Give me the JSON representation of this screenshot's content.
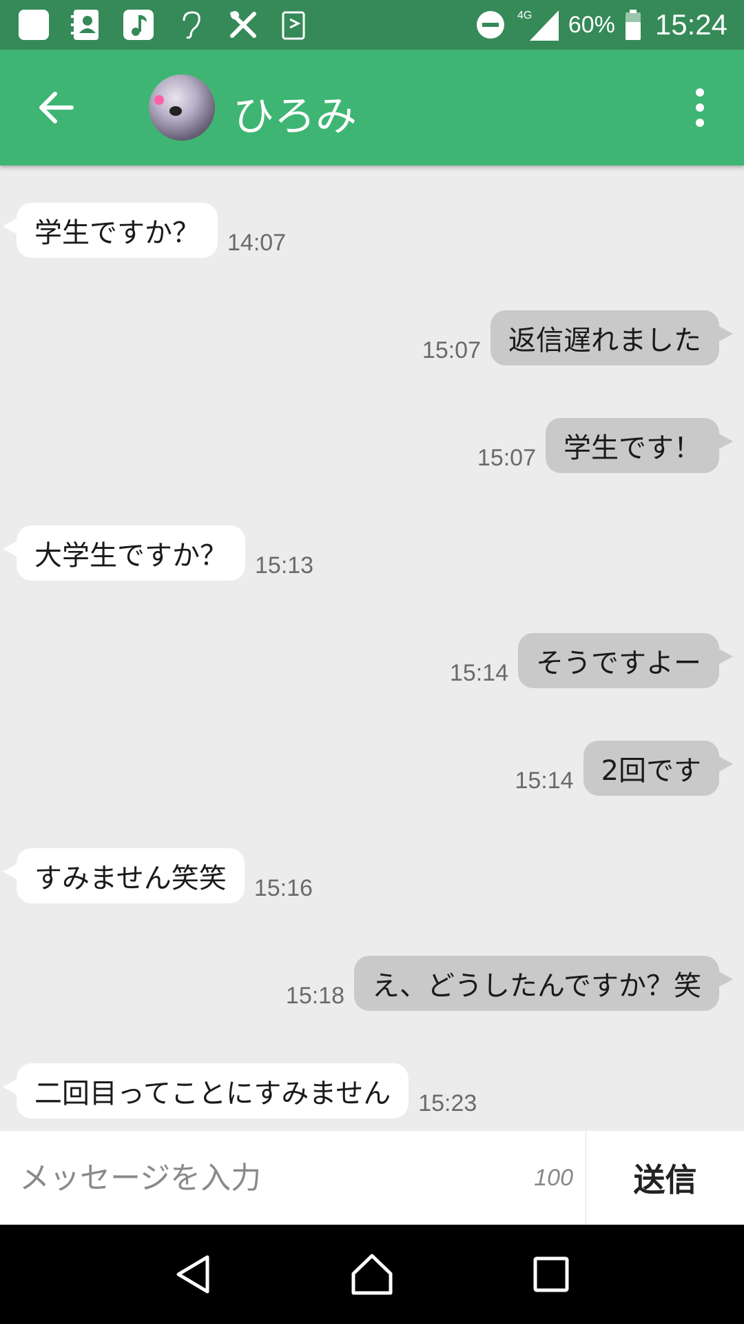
{
  "status_bar": {
    "icons": [
      "notification-square-icon",
      "contacts-icon",
      "music-icon",
      "hearing-icon",
      "tools-icon",
      "cards-icon",
      "do-not-disturb-icon",
      "signal-4g-icon",
      "battery-icon"
    ],
    "network": "4G",
    "battery": "60%",
    "time": "15:24"
  },
  "header": {
    "contact_name": "ひろみ",
    "back_icon": "arrow-left-icon",
    "menu_icon": "more-vert-icon"
  },
  "messages": [
    {
      "side": "left",
      "text": "学生ですか？",
      "time": "14:07"
    },
    {
      "side": "right",
      "text": "返信遅れました",
      "time": "15:07"
    },
    {
      "side": "right",
      "text": "学生です！",
      "time": "15:07"
    },
    {
      "side": "left",
      "text": "大学生ですか？",
      "time": "15:13"
    },
    {
      "side": "right",
      "text": "そうですよー",
      "time": "15:14"
    },
    {
      "side": "right",
      "text": "2回です",
      "time": "15:14"
    },
    {
      "side": "left",
      "text": "すみません笑笑",
      "time": "15:16"
    },
    {
      "side": "right",
      "text": "え、どうしたんですか？笑",
      "time": "15:18"
    },
    {
      "side": "left",
      "text": "二回目ってことにすみません",
      "time": "15:23"
    }
  ],
  "input": {
    "placeholder": "メッセージを入力",
    "char_count": "100",
    "send_label": "送信"
  },
  "nav_bar": {
    "icons": [
      "back-triangle-icon",
      "home-icon",
      "recents-icon"
    ]
  },
  "colors": {
    "status_bar": "#358a58",
    "app_bar": "#3fb574",
    "chat_bg": "#ececec",
    "incoming_bubble": "#ffffff",
    "outgoing_bubble": "#c9c9c9"
  }
}
